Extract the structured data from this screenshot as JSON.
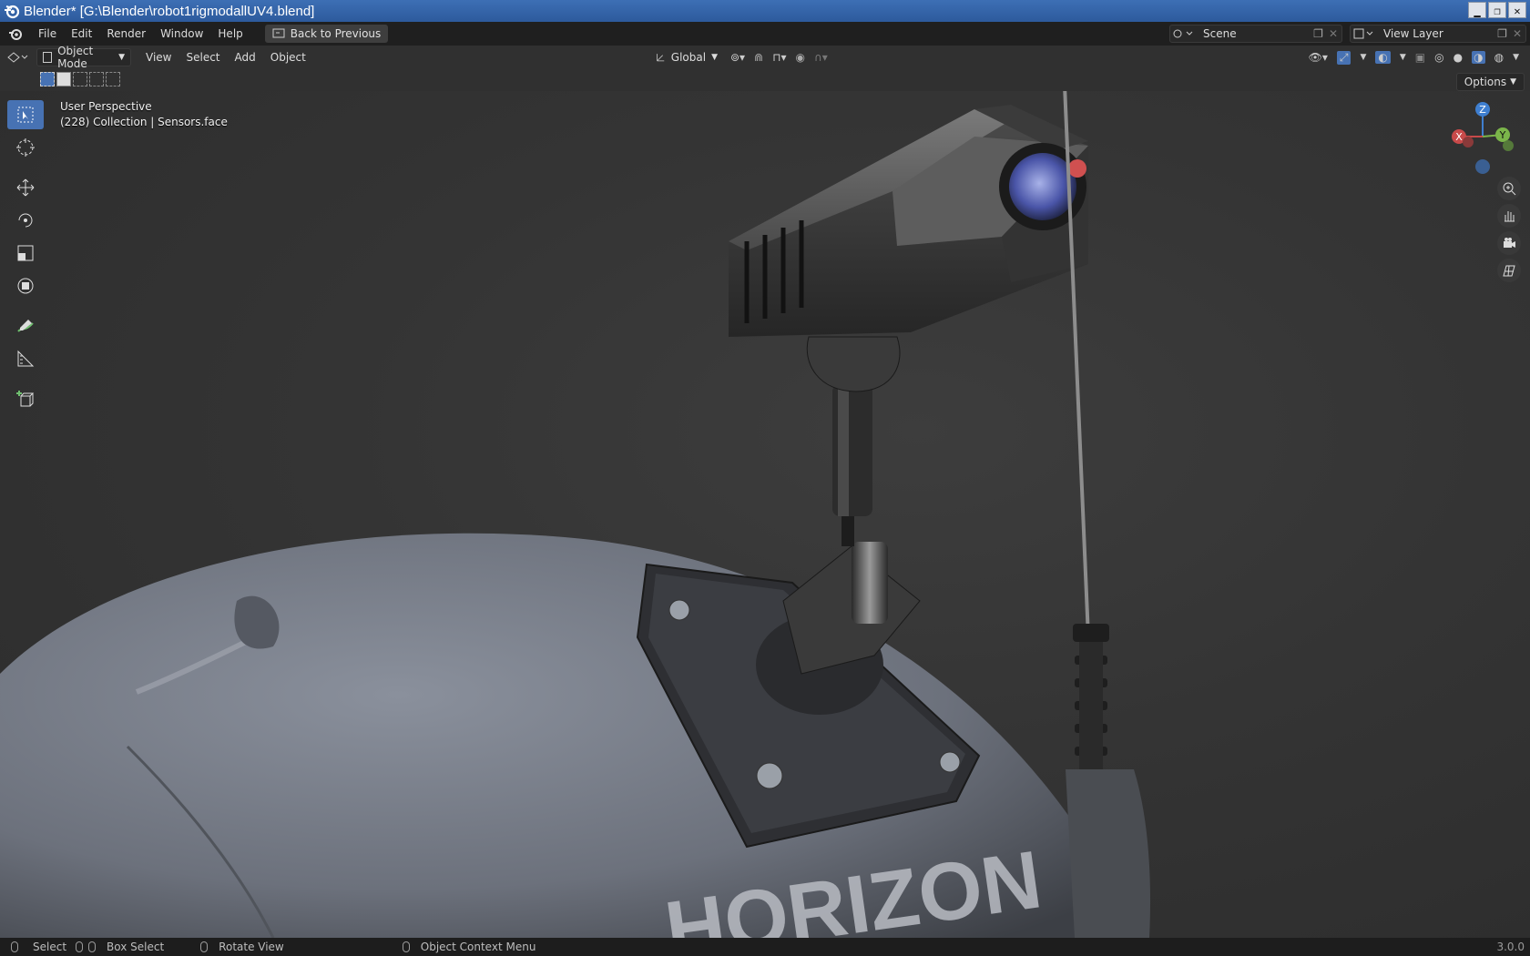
{
  "window": {
    "title": "Blender* [G:\\Blender\\robot1rigmodallUV4.blend]",
    "buttons": [
      "▁",
      "❐",
      "✕"
    ]
  },
  "menubar": {
    "items": [
      "File",
      "Edit",
      "Render",
      "Window",
      "Help"
    ],
    "back_label": "Back to Previous",
    "scene_label": "Scene",
    "view_layer_label": "View Layer"
  },
  "viewport_header": {
    "mode_label": "Object Mode",
    "menus": [
      "View",
      "Select",
      "Add",
      "Object"
    ],
    "orientation_label": "Global",
    "options_label": "Options"
  },
  "viewport": {
    "perspective_label": "User Perspective",
    "collection_label": "(228) Collection | Sensors.face",
    "logo_text": "HORIZON",
    "gizmo": {
      "z": "Z",
      "x": "X",
      "y": "Y"
    }
  },
  "toolbar": {
    "tools": [
      "select-box",
      "cursor",
      "move",
      "rotate",
      "scale",
      "transform",
      "annotate",
      "measure",
      "add-cube"
    ]
  },
  "statusbar": {
    "select_label": "Select",
    "box_select_label": "Box Select",
    "rotate_label": "Rotate View",
    "context_label": "Object Context Menu",
    "version": "3.0.0"
  },
  "colors": {
    "accent": "#4772b3",
    "titlebar": "#2d5a9c",
    "background": "#2b2b2b"
  }
}
